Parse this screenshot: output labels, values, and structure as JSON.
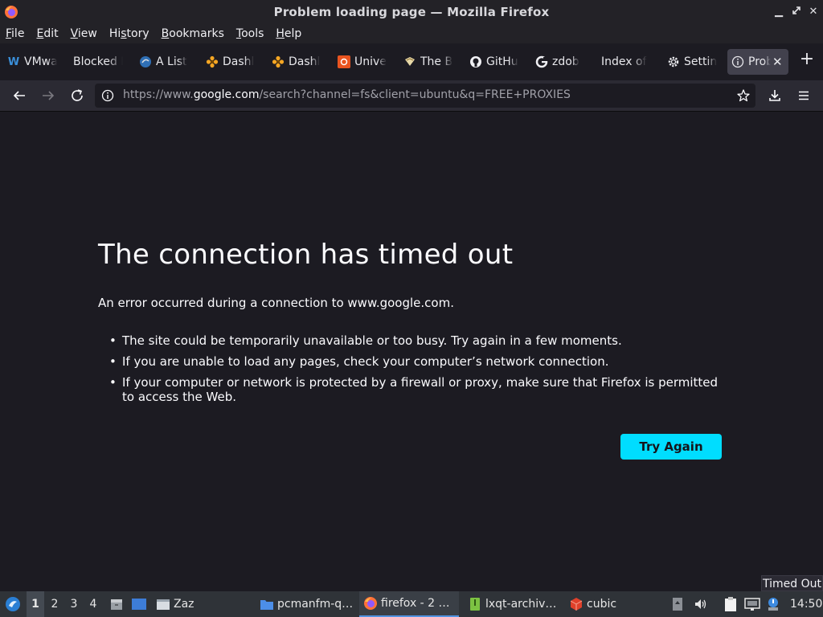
{
  "window": {
    "title": "Problem loading page — Mozilla Firefox"
  },
  "menubar": {
    "items": [
      {
        "accel": "F",
        "rest": "ile"
      },
      {
        "accel": "E",
        "rest": "dit"
      },
      {
        "accel": "V",
        "rest": "iew"
      },
      {
        "pre": "Hi",
        "accel": "s",
        "rest": "tory"
      },
      {
        "accel": "B",
        "rest": "ookmarks"
      },
      {
        "accel": "T",
        "rest": "ools"
      },
      {
        "accel": "H",
        "rest": "elp"
      }
    ]
  },
  "tabs": [
    {
      "label": "VMwa",
      "icon": "vmware-w-icon"
    },
    {
      "label": "Blocked I",
      "icon": "none"
    },
    {
      "label": "A List",
      "icon": "globe-bird-icon"
    },
    {
      "label": "Dashl",
      "icon": "flower-icon"
    },
    {
      "label": "Dashl",
      "icon": "flower-icon"
    },
    {
      "label": "Unive",
      "icon": "ubuntu-icon"
    },
    {
      "label": "The B",
      "icon": "scroll-icon"
    },
    {
      "label": "GitHu",
      "icon": "github-icon"
    },
    {
      "label": "zdob",
      "icon": "google-icon"
    },
    {
      "label": "Index of",
      "icon": "none"
    },
    {
      "label": "Settin",
      "icon": "gear-icon"
    },
    {
      "label": "Prob",
      "icon": "info-icon",
      "active": true
    }
  ],
  "navbar": {
    "url_prefix": "https://www.",
    "url_host": "google.com",
    "url_rest": "/search?channel=fs&client=ubuntu&q=FREE+PROXIES"
  },
  "error": {
    "title": "The connection has timed out",
    "description": "An error occurred during a connection to www.google.com.",
    "bullets": [
      "The site could be temporarily unavailable or too busy. Try again in a few moments.",
      "If you are unable to load any pages, check your computer’s network connection.",
      "If your computer or network is protected by a firewall or proxy, make sure that Firefox is permitted to access the Web."
    ],
    "try_again": "Try Again"
  },
  "tooltip": "Timed Out",
  "taskbar": {
    "desktops": [
      "1",
      "2",
      "3",
      "4"
    ],
    "tasks": [
      {
        "label": "Zaz",
        "icon": "window-icon"
      },
      {
        "label": "pcmanfm-q…",
        "icon": "folder-icon"
      },
      {
        "label": "firefox - 2 …",
        "icon": "firefox-icon",
        "active": true
      },
      {
        "label": "lxqt-archiv…",
        "icon": "archive-icon"
      },
      {
        "label": "cubic",
        "icon": "cubic-icon"
      }
    ],
    "clock": "14:50"
  }
}
